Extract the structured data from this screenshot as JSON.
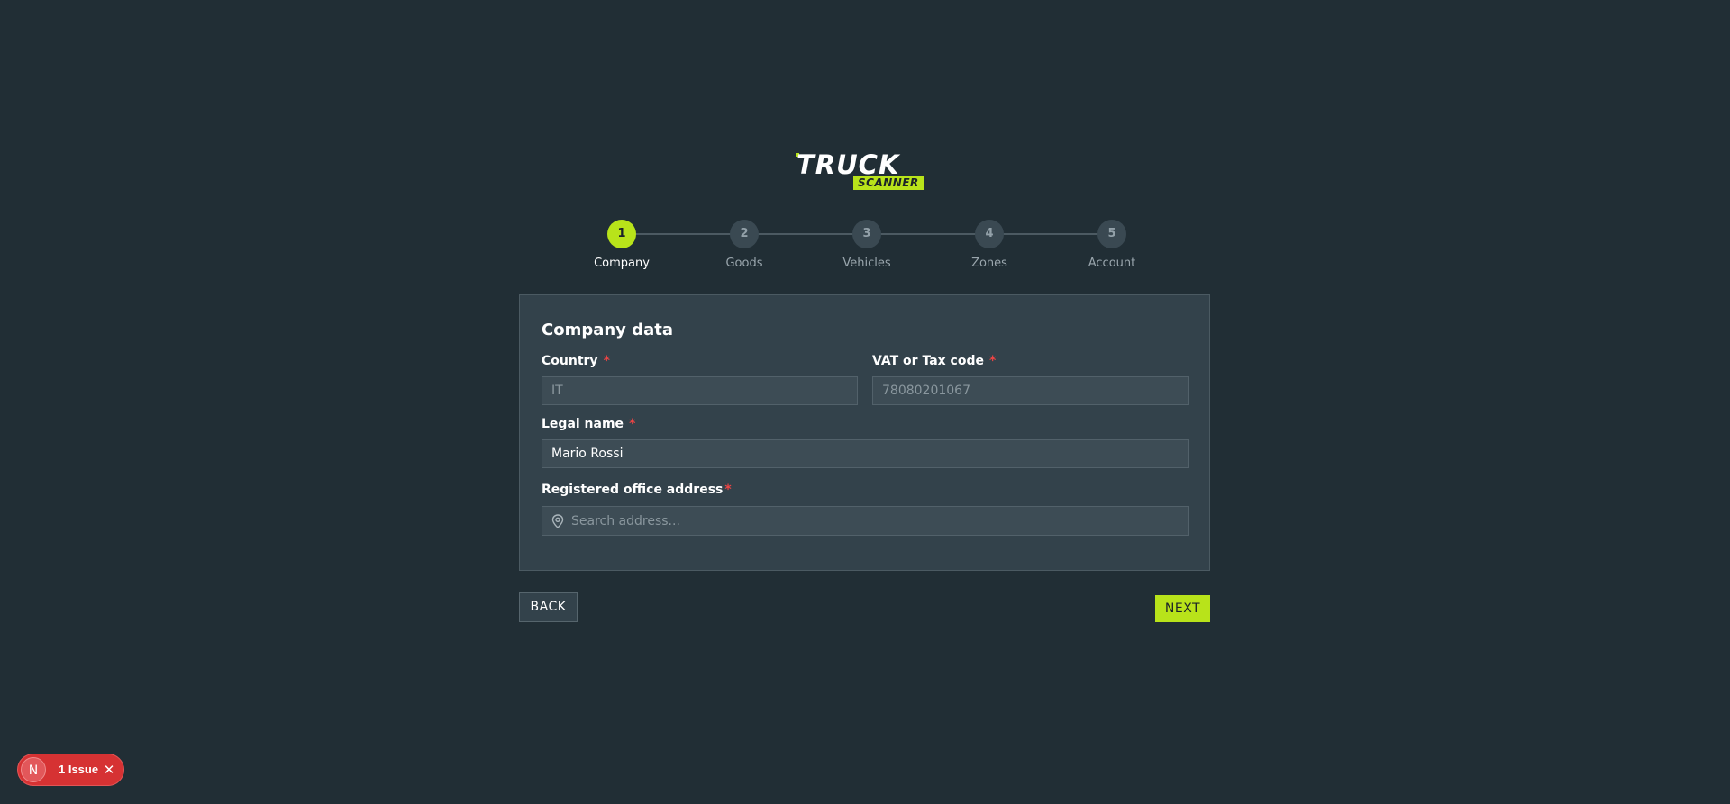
{
  "brand": {
    "logo_word": "TRUCK",
    "logo_sub": "SCANNER",
    "accent_color": "#b8e31a"
  },
  "stepper": {
    "steps": [
      {
        "number": "1",
        "label": "Company",
        "active": true
      },
      {
        "number": "2",
        "label": "Goods",
        "active": false
      },
      {
        "number": "3",
        "label": "Vehicles",
        "active": false
      },
      {
        "number": "4",
        "label": "Zones",
        "active": false
      },
      {
        "number": "5",
        "label": "Account",
        "active": false
      }
    ]
  },
  "form": {
    "title": "Company data",
    "country": {
      "label": "Country",
      "required": "*",
      "value": "IT"
    },
    "vat": {
      "label": "VAT or Tax code",
      "required": "*",
      "value": "78080201067"
    },
    "legal_name": {
      "label": "Legal name",
      "required": "*",
      "value": "Mario Rossi"
    },
    "address": {
      "label": "Registered office address",
      "required": "*",
      "placeholder": "Search address...",
      "icon": "map-pin-icon"
    }
  },
  "actions": {
    "back_label": "BACK",
    "next_label": "NEXT"
  },
  "issues_badge": {
    "initial": "N",
    "label": "1 Issue",
    "close_glyph": "✕",
    "color": "#d63233"
  }
}
